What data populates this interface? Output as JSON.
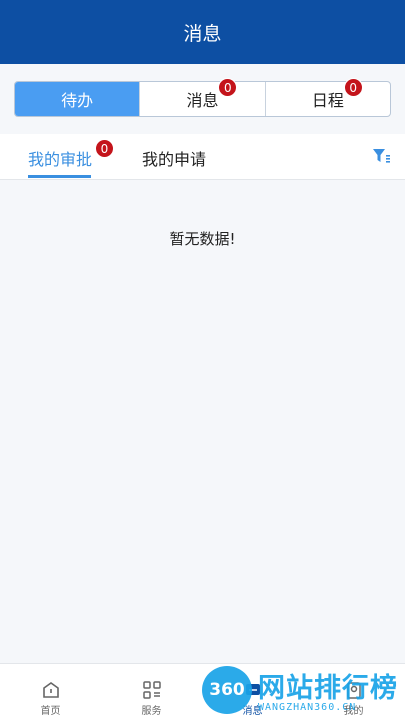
{
  "header": {
    "title": "消息"
  },
  "segments": [
    {
      "label": "待办",
      "badge": ""
    },
    {
      "label": "消息",
      "badge": "0"
    },
    {
      "label": "日程",
      "badge": "0"
    }
  ],
  "subtabs": [
    {
      "label": "我的审批",
      "badge": "0"
    },
    {
      "label": "我的申请"
    }
  ],
  "empty_text": "暂无数据!",
  "tabbar": [
    {
      "label": "首页",
      "icon": "home-icon"
    },
    {
      "label": "服务",
      "icon": "grid-icon"
    },
    {
      "label": "消息",
      "icon": "message-icon"
    },
    {
      "label": "我的",
      "icon": "user-icon"
    }
  ],
  "watermark": {
    "logo": "360",
    "text": "网站排行榜",
    "sub": "WANGZHAN360.CN"
  },
  "colors": {
    "brand": "#0d4fa3",
    "accent": "#4a9df2",
    "badge": "#c4141b"
  }
}
